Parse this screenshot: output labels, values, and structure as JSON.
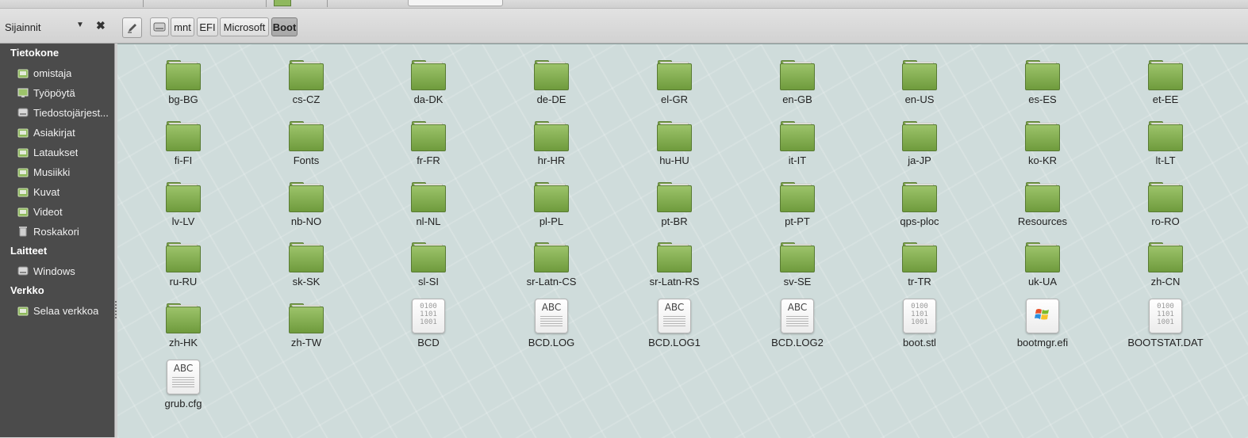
{
  "sidebar_header": {
    "title": "Sijainnit",
    "dropdown_icon": "chevron-down-icon",
    "close_icon": "close-icon"
  },
  "breadcrumb": {
    "edit_icon": "pencil-icon",
    "drive_icon": "drive-icon",
    "items": [
      "mnt",
      "EFI",
      "Microsoft",
      "Boot"
    ],
    "active": "Boot"
  },
  "sidebar": {
    "sections": [
      {
        "heading": "Tietokone",
        "items": [
          {
            "label": "omistaja",
            "icon": "home-folder-icon"
          },
          {
            "label": "Työpöytä",
            "icon": "desktop-icon"
          },
          {
            "label": "Tiedostojärjest...",
            "icon": "filesystem-icon"
          },
          {
            "label": "Asiakirjat",
            "icon": "documents-folder-icon"
          },
          {
            "label": "Lataukset",
            "icon": "downloads-folder-icon"
          },
          {
            "label": "Musiikki",
            "icon": "music-folder-icon"
          },
          {
            "label": "Kuvat",
            "icon": "pictures-folder-icon"
          },
          {
            "label": "Videot",
            "icon": "videos-folder-icon"
          },
          {
            "label": "Roskakori",
            "icon": "trash-icon"
          }
        ]
      },
      {
        "heading": "Laitteet",
        "items": [
          {
            "label": "Windows",
            "icon": "drive-icon"
          }
        ]
      },
      {
        "heading": "Verkko",
        "items": [
          {
            "label": "Selaa verkkoa",
            "icon": "network-icon"
          }
        ]
      }
    ]
  },
  "files": [
    {
      "name": "bg-BG",
      "type": "folder"
    },
    {
      "name": "cs-CZ",
      "type": "folder"
    },
    {
      "name": "da-DK",
      "type": "folder"
    },
    {
      "name": "de-DE",
      "type": "folder"
    },
    {
      "name": "el-GR",
      "type": "folder"
    },
    {
      "name": "en-GB",
      "type": "folder"
    },
    {
      "name": "en-US",
      "type": "folder"
    },
    {
      "name": "es-ES",
      "type": "folder"
    },
    {
      "name": "et-EE",
      "type": "folder"
    },
    {
      "name": "fi-FI",
      "type": "folder"
    },
    {
      "name": "Fonts",
      "type": "folder"
    },
    {
      "name": "fr-FR",
      "type": "folder"
    },
    {
      "name": "hr-HR",
      "type": "folder"
    },
    {
      "name": "hu-HU",
      "type": "folder"
    },
    {
      "name": "it-IT",
      "type": "folder"
    },
    {
      "name": "ja-JP",
      "type": "folder"
    },
    {
      "name": "ko-KR",
      "type": "folder"
    },
    {
      "name": "lt-LT",
      "type": "folder"
    },
    {
      "name": "lv-LV",
      "type": "folder"
    },
    {
      "name": "nb-NO",
      "type": "folder"
    },
    {
      "name": "nl-NL",
      "type": "folder"
    },
    {
      "name": "pl-PL",
      "type": "folder"
    },
    {
      "name": "pt-BR",
      "type": "folder"
    },
    {
      "name": "pt-PT",
      "type": "folder"
    },
    {
      "name": "qps-ploc",
      "type": "folder"
    },
    {
      "name": "Resources",
      "type": "folder"
    },
    {
      "name": "ro-RO",
      "type": "folder"
    },
    {
      "name": "ru-RU",
      "type": "folder"
    },
    {
      "name": "sk-SK",
      "type": "folder"
    },
    {
      "name": "sl-SI",
      "type": "folder"
    },
    {
      "name": "sr-Latn-CS",
      "type": "folder"
    },
    {
      "name": "sr-Latn-RS",
      "type": "folder"
    },
    {
      "name": "sv-SE",
      "type": "folder"
    },
    {
      "name": "tr-TR",
      "type": "folder"
    },
    {
      "name": "uk-UA",
      "type": "folder"
    },
    {
      "name": "zh-CN",
      "type": "folder"
    },
    {
      "name": "zh-HK",
      "type": "folder"
    },
    {
      "name": "zh-TW",
      "type": "folder"
    },
    {
      "name": "BCD",
      "type": "binary"
    },
    {
      "name": "BCD.LOG",
      "type": "text"
    },
    {
      "name": "BCD.LOG1",
      "type": "text"
    },
    {
      "name": "BCD.LOG2",
      "type": "text"
    },
    {
      "name": "boot.stl",
      "type": "binary"
    },
    {
      "name": "bootmgr.efi",
      "type": "executable"
    },
    {
      "name": "BOOTSTAT.DAT",
      "type": "binary"
    },
    {
      "name": "grub.cfg",
      "type": "text"
    }
  ],
  "icon_glyphs": {
    "text": "ABC",
    "binary": "0100\n1101\n1001"
  },
  "colors": {
    "sidebar_bg": "#4b4b4b",
    "folder_green": "#8cb55a",
    "main_bg": "#cfdcdb"
  }
}
